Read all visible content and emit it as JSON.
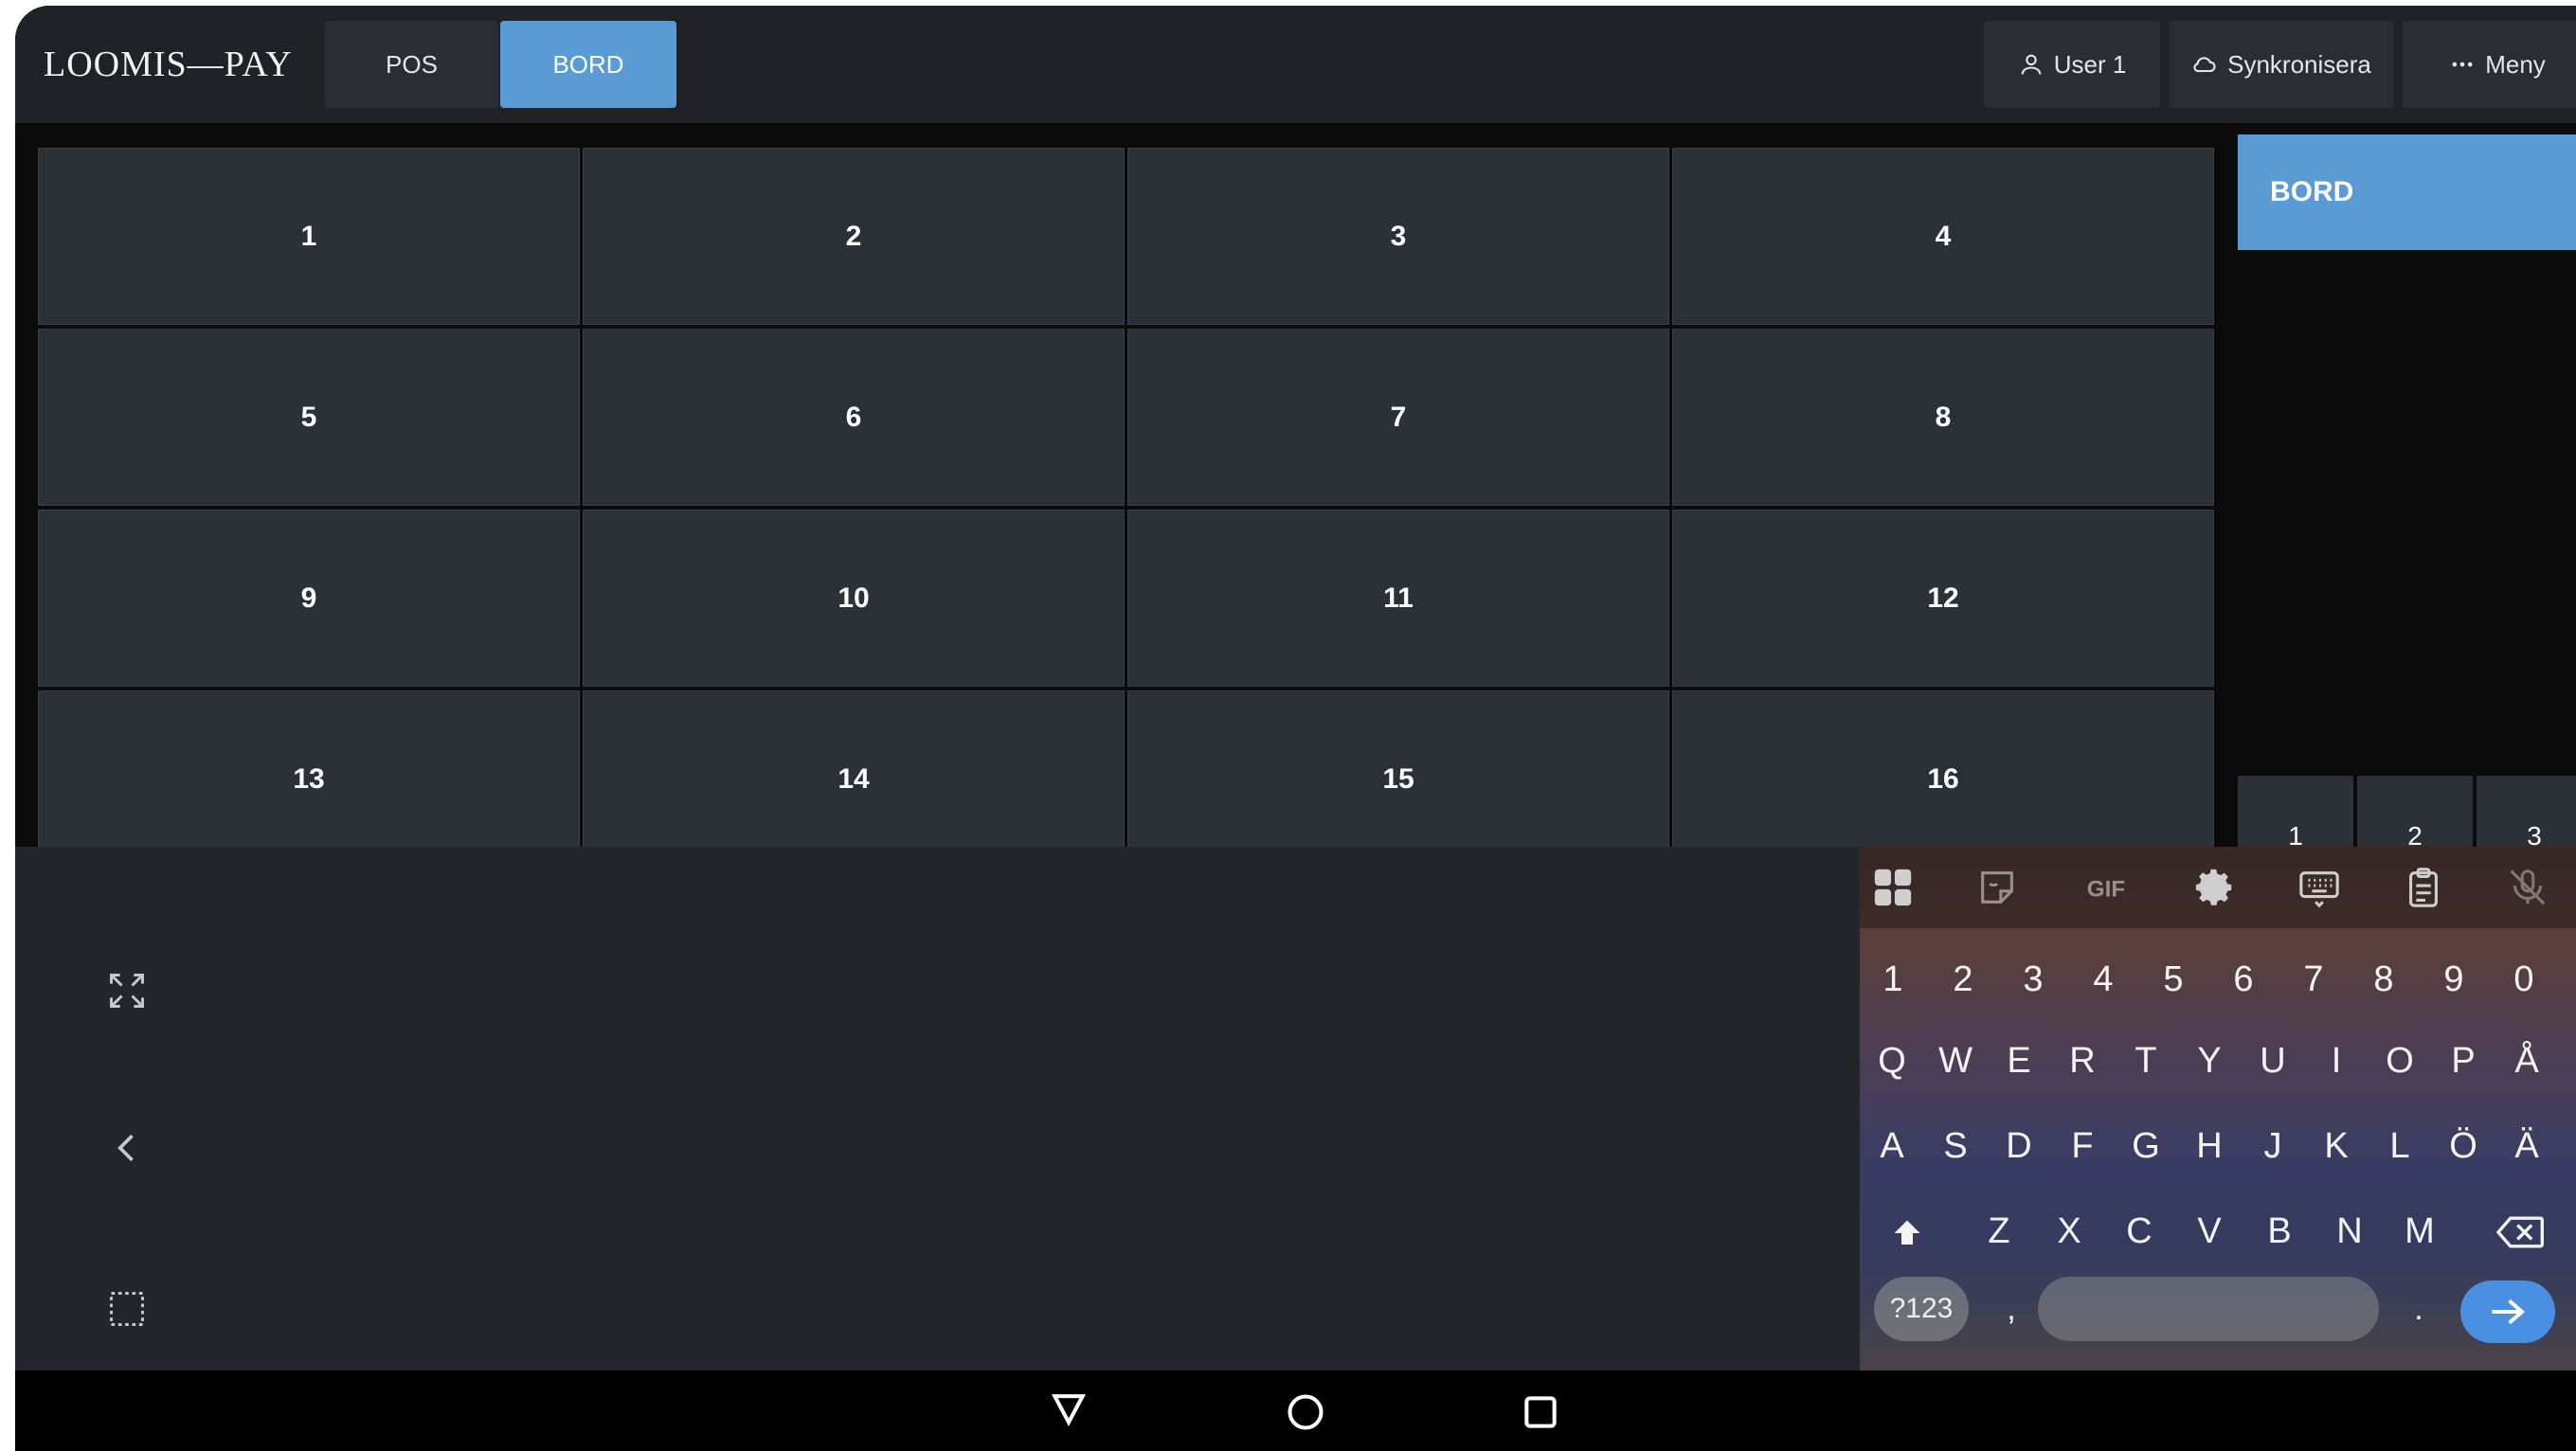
{
  "header": {
    "logo": "LOOMIS—PAY",
    "tabs": [
      {
        "label": "POS",
        "active": false
      },
      {
        "label": "BORD",
        "active": true
      }
    ],
    "user_label": "User 1",
    "sync_label": "Synkronisera",
    "menu_label": "Meny"
  },
  "tables": [
    "1",
    "2",
    "3",
    "4",
    "5",
    "6",
    "7",
    "8",
    "9",
    "10",
    "11",
    "12",
    "13",
    "14",
    "15",
    "16"
  ],
  "right_panel": {
    "title": "BORD",
    "numbers": [
      "1",
      "2",
      "3"
    ]
  },
  "keyboard": {
    "number_row": [
      "1",
      "2",
      "3",
      "4",
      "5",
      "6",
      "7",
      "8",
      "9",
      "0"
    ],
    "row1": [
      "Q",
      "W",
      "E",
      "R",
      "T",
      "Y",
      "U",
      "I",
      "O",
      "P",
      "Å"
    ],
    "row2": [
      "A",
      "S",
      "D",
      "F",
      "G",
      "H",
      "J",
      "K",
      "L",
      "Ö",
      "Ä"
    ],
    "row3": [
      "Z",
      "X",
      "C",
      "V",
      "B",
      "N",
      "M"
    ],
    "symbols_label": "?123",
    "comma": ",",
    "period": ".",
    "toolbar_icons": [
      "apps-icon",
      "sticker-icon",
      "gif-icon",
      "settings-icon",
      "keyboard-icon",
      "clipboard-icon",
      "mic-off-icon"
    ]
  },
  "colors": {
    "accent": "#5b9bd5",
    "tile": "#2c3137",
    "topbar": "#202226"
  }
}
